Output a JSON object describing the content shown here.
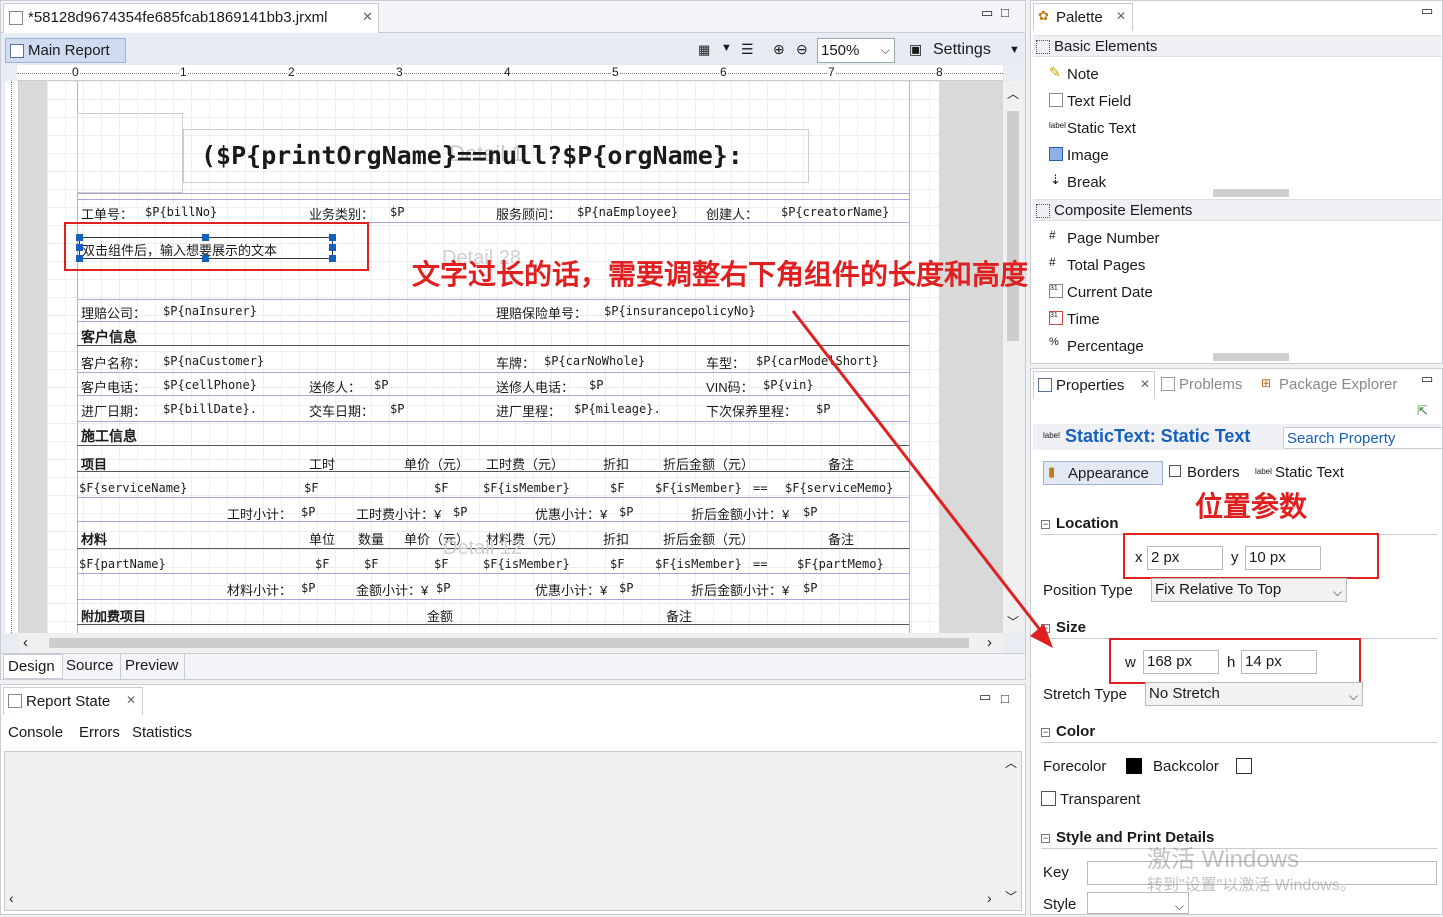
{
  "editor": {
    "file_tab": "*58128d9674354fe685fcab1869141bb3.jrxml",
    "report_tab": "Main Report",
    "zoom": "150%",
    "settings": "Settings",
    "ruler_marks": [
      "0",
      "1",
      "2",
      "3",
      "4",
      "5",
      "6",
      "7",
      "8"
    ],
    "bottom_tabs": [
      "Design",
      "Source",
      "Preview"
    ]
  },
  "report": {
    "title_expr": "($P{printOrgName}==null?$P{orgName}:",
    "band_detail1": "Detail 1",
    "band_detail28": "Detail 28",
    "band_detail12": "Detail 12",
    "selected_text": "双击组件后，输入想要展示的文本",
    "annotation_main": "文字过长的话，需要调整右下角组件的长度和高度",
    "row1": [
      "工单号：",
      "$P{billNo}",
      "业务类别：",
      "$P",
      "服务顾问：",
      "$P{naEmployee}",
      "创建人：",
      "$P{creatorName}"
    ],
    "row2": [
      "理赔公司：",
      "$P{naInsurer}",
      "理赔保险单号：",
      "$P{insurancepolicyNo}"
    ],
    "sec_customer": "客户信息",
    "row3": [
      "客户名称：",
      "$P{naCustomer}",
      "车牌：",
      "$P{carNoWhole}",
      "车型：",
      "$P{carModelShort}"
    ],
    "row4": [
      "客户电话：",
      "$P{cellPhone}",
      "送修人：",
      "$P",
      "送修人电话：",
      "$P",
      "VIN码：",
      "$P{vin}"
    ],
    "row5": [
      "进厂日期：",
      "$P{billDate}.",
      "交车日期：",
      "$P",
      "进厂里程：",
      "$P{mileage}.",
      "下次保养里程：",
      "$P"
    ],
    "sec_work": "施工信息",
    "work_header": [
      "项目",
      "工时",
      "单价（元）",
      "工时费（元）",
      "折扣",
      "折后金额（元）",
      "备注"
    ],
    "work_row": [
      "$F{serviceName}",
      "$F",
      "$F",
      "$F{isMember}",
      "$F",
      "$F{isMember}",
      "==",
      "$F{serviceMemo}"
    ],
    "work_sub": [
      "工时小计：",
      "$P",
      "工时费小计：¥",
      "$P",
      "优惠小计：¥",
      "$P",
      "折后金额小计：¥",
      "$P"
    ],
    "material_header": [
      "材料",
      "单位",
      "数量",
      "单价（元）",
      "材料费（元）",
      "折扣",
      "折后金额（元）",
      "备注"
    ],
    "material_row": [
      "$F{partName}",
      "$F",
      "$F",
      "$F",
      "$F{isMember}",
      "$F",
      "$F{isMember}",
      "==",
      "$F{partMemo}"
    ],
    "material_sub": [
      "材料小计：",
      "$P",
      "金额小计：¥",
      "$P",
      "优惠小计：¥",
      "$P",
      "折后金额小计：¥",
      "$P"
    ],
    "extra_header": [
      "附加费项目",
      "金额",
      "备注"
    ]
  },
  "report_state": {
    "tab": "Report State",
    "subtabs": [
      "Console",
      "Errors",
      "Statistics"
    ]
  },
  "palette": {
    "tab": "Palette",
    "basic": "Basic Elements",
    "basic_items": [
      "Note",
      "Text Field",
      "Static Text",
      "Image",
      "Break"
    ],
    "composite": "Composite Elements",
    "composite_items": [
      "Page Number",
      "Total Pages",
      "Current Date",
      "Time",
      "Percentage"
    ]
  },
  "properties": {
    "tabs": [
      "Properties",
      "Problems",
      "Package Explorer"
    ],
    "title": "StaticText: Static Text",
    "search": "Search Property",
    "subtabs": [
      "Appearance",
      "Borders",
      "Static Text"
    ],
    "annotation": "位置参数",
    "location": "Location",
    "x_label": "x",
    "x_value": "2 px",
    "y_label": "y",
    "y_value": "10 px",
    "position_type_label": "Position Type",
    "position_type": "Fix Relative To Top",
    "size": "Size",
    "w_label": "w",
    "w_value": "168 px",
    "h_label": "h",
    "h_value": "14 px",
    "stretch_label": "Stretch Type",
    "stretch": "No Stretch",
    "color": "Color",
    "forecolor": "Forecolor",
    "backcolor": "Backcolor",
    "transparent": "Transparent",
    "style_print": "Style and Print Details",
    "key": "Key",
    "style": "Style",
    "watermark1": "激活 Windows",
    "watermark2": "转到\"设置\"以激活 Windows。"
  },
  "colors": {
    "annotation_red": "#e02020",
    "selection_blue": "#1560bd",
    "band_line": "#a7a7d9"
  }
}
